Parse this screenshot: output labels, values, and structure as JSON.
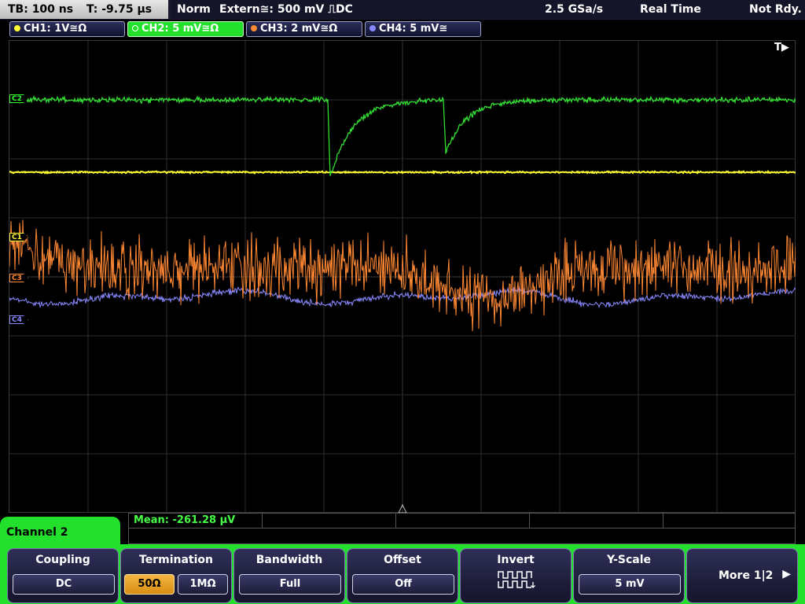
{
  "top": {
    "timebase": "TB: 100 ns",
    "trigger_time": "T: -9.75 µs",
    "mode": "Norm",
    "trigger_source": "Extern≅: 500 mV ⎍DC",
    "sample_rate": "2.5 GSa/s",
    "acquisition": "Real Time",
    "state": "Not Rdy."
  },
  "channels": [
    {
      "label": "CH1: 1V≅Ω",
      "color": "#ffff33"
    },
    {
      "label": "CH2: 5 mV≅Ω",
      "color": "#33ff33"
    },
    {
      "label": "CH3: 2 mV≅Ω",
      "color": "#ff8833"
    },
    {
      "label": "CH4: 5 mV≅",
      "color": "#8888ff"
    }
  ],
  "trigger_indicator": "T▶",
  "markers": {
    "c1": "C1",
    "c2": "C2",
    "c3": "C3",
    "c4": "C4"
  },
  "measurement": {
    "mean": "Mean: -261.28 µV"
  },
  "menu": {
    "channel_title": "Channel 2",
    "coupling": {
      "title": "Coupling",
      "value": "DC"
    },
    "termination": {
      "title": "Termination",
      "opt1": "50Ω",
      "opt2": "1MΩ"
    },
    "bandwidth": {
      "title": "Bandwidth",
      "value": "Full"
    },
    "offset": {
      "title": "Offset",
      "value": "Off"
    },
    "invert": {
      "title": "Invert"
    },
    "yscale": {
      "title": "Y-Scale",
      "value": "5 mV"
    },
    "more": {
      "label": "More 1|2"
    }
  },
  "colors": {
    "grid": "#2e2e2e",
    "green": "#22e02c"
  }
}
